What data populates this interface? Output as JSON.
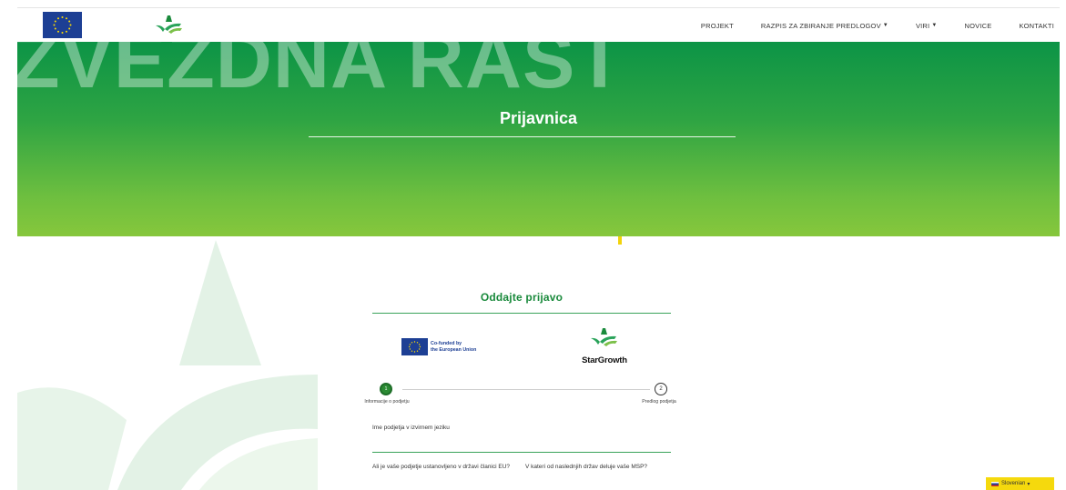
{
  "header": {
    "logo_icon": "eu-flag-icon",
    "brand_icon": "stargrowth-logo-icon",
    "nav": [
      {
        "label": "PROJEKT",
        "dropdown": false
      },
      {
        "label": "RAZPIS ZA ZBIRANJE PREDLOGOV",
        "dropdown": true
      },
      {
        "label": "VIRI",
        "dropdown": true
      },
      {
        "label": "NOVICE",
        "dropdown": false
      },
      {
        "label": "KONTAKTI",
        "dropdown": false
      }
    ]
  },
  "hero": {
    "watermark_text": "ZVEZDNA RAST",
    "title": "Prijavnica"
  },
  "form": {
    "title": "Oddajte prijavo",
    "eu_badge_text_1": "Co-funded by",
    "eu_badge_text_2": "the European Union",
    "brand_name": "StarGrowth",
    "steps": [
      {
        "number": "1",
        "label": "Informacije o podjetju",
        "active": true
      },
      {
        "number": "2",
        "label": "Predlog podjetja",
        "active": false
      }
    ],
    "fields": {
      "company_name_label": "Ime podjetja v izvirnem jeziku",
      "q_eu_member": "Ali je vaše podjetje ustanovljeno v državi članici EU?",
      "q_country": "V kateri od naslednjih držav deluje vaše MSP?"
    }
  },
  "language": {
    "label": "Slovenian",
    "caret": "▾"
  },
  "colors": {
    "brand_green": "#1a8a3c",
    "hero_top": "#0c9446",
    "hero_bottom": "#86c73c",
    "eu_blue": "#1d3f94",
    "lang_yellow": "#f5d90d"
  }
}
